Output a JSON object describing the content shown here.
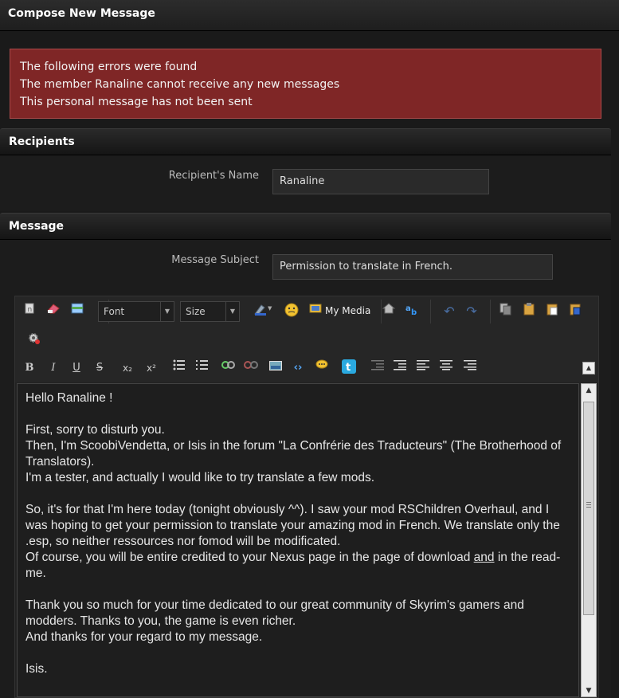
{
  "page": {
    "title": "Compose New Message"
  },
  "errors": {
    "lines": [
      "The following errors were found",
      "The member Ranaline cannot receive any new messages",
      "This personal message has not been sent"
    ]
  },
  "recipients": {
    "header": "Recipients",
    "name_label": "Recipient's Name",
    "name_value": "Ranaline"
  },
  "message": {
    "header": "Message",
    "subject_label": "Message Subject",
    "subject_value": "Permission to translate in French."
  },
  "toolbar": {
    "font_label": "Font",
    "size_label": "Size",
    "media_label": "My Media",
    "bold": "B",
    "italic": "I",
    "underline": "U",
    "strike": "S",
    "subscript": "x₂",
    "superscript": "x²"
  },
  "body": {
    "greeting": "Hello Ranaline !",
    "p1_l1": "First, sorry to disturb you.",
    "p1_l2": "Then, I'm ScoobiVendetta, or Isis in the forum \"La Confrérie des Traducteurs\" (The Brotherhood of Translators).",
    "p1_l3": "I'm a tester, and actually I would like to try translate a few mods.",
    "p2_l1": "So, it's for that I'm here today (tonight obviously ^^). I saw your mod RSChildren Overhaul, and I was hoping to get your permission to translate your amazing mod in French. We translate only the .esp, so neither ressources nor fomod will be modificated.",
    "p2_l2_a": "Of course, you will be entire credited to your Nexus page in the page of download ",
    "p2_l2_u": "and",
    "p2_l2_b": " in the read-me.",
    "p3_l1": "Thank you so much for your time dedicated to our great community of Skyrim's gamers and modders. Thanks to you, the game is even richer.",
    "p3_l2": "And thanks for your regard to my message.",
    "signature": "Isis."
  }
}
